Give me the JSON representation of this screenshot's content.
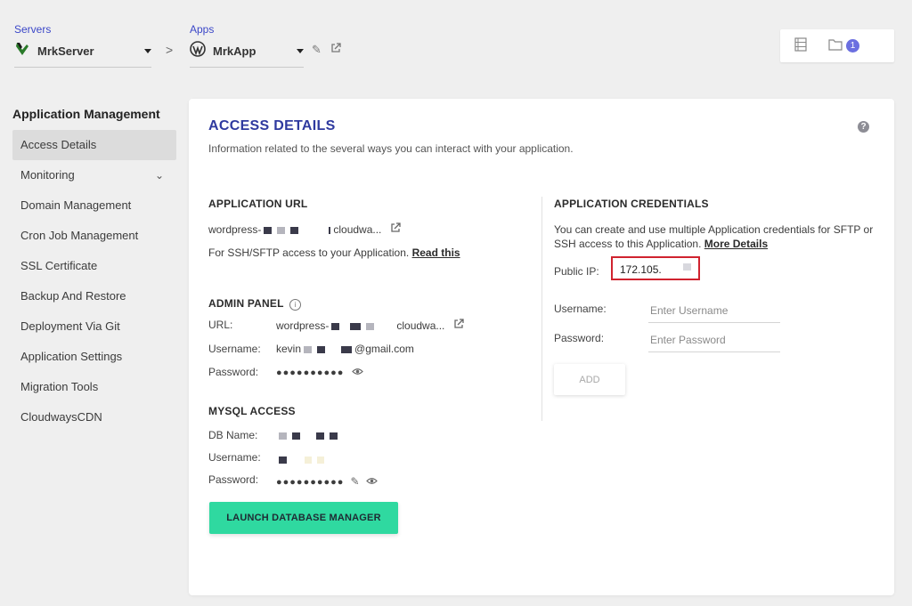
{
  "breadcrumb": {
    "servers_label": "Servers",
    "server_name": "MrkServer",
    "apps_label": "Apps",
    "app_name": "MrkApp",
    "separator": ">"
  },
  "topbar": {
    "notification_count": "1"
  },
  "sidebar": {
    "title": "Application Management",
    "items": [
      {
        "label": "Access Details",
        "active": true
      },
      {
        "label": "Monitoring"
      },
      {
        "label": "Domain Management"
      },
      {
        "label": "Cron Job Management"
      },
      {
        "label": "SSL Certificate"
      },
      {
        "label": "Backup And Restore"
      },
      {
        "label": "Deployment Via Git"
      },
      {
        "label": "Application Settings"
      },
      {
        "label": "Migration Tools"
      },
      {
        "label": "CloudwaysCDN"
      }
    ]
  },
  "main": {
    "title": "ACCESS DETAILS",
    "subtitle": "Information related to the several ways you can interact with your application.",
    "help": "?",
    "app_url": {
      "heading": "APPLICATION URL",
      "url_prefix": "wordpress-",
      "url_suffix": "cloudwa...",
      "ssh_text": "For SSH/SFTP access to your Application.",
      "read_this": "Read this"
    },
    "admin_panel": {
      "heading": "ADMIN PANEL",
      "info": "i",
      "url_label": "URL:",
      "url_prefix": "wordpress-",
      "url_suffix": "cloudwa...",
      "username_label": "Username:",
      "username_prefix": "kevin",
      "username_suffix": "@gmail.com",
      "password_label": "Password:",
      "password_mask": "●●●●●●●●●●"
    },
    "mysql": {
      "heading": "MYSQL ACCESS",
      "dbname_label": "DB Name:",
      "username_label": "Username:",
      "password_label": "Password:",
      "password_mask": "●●●●●●●●●●",
      "launch_button": "LAUNCH DATABASE MANAGER"
    },
    "credentials": {
      "heading": "APPLICATION CREDENTIALS",
      "description": "You can create and use multiple Application credentials for SFTP or SSH access to this Application.",
      "more_details": "More Details",
      "public_ip_label": "Public IP:",
      "public_ip_value": "172.105.",
      "username_label": "Username:",
      "username_placeholder": "Enter Username",
      "password_label": "Password:",
      "password_placeholder": "Enter Password",
      "add_button": "ADD"
    }
  },
  "colors": {
    "accent_blue": "#2f3a9f",
    "launch_green": "#2fd9a0",
    "highlight_red": "#d0232f",
    "badge_purple": "#6b6fe0"
  }
}
